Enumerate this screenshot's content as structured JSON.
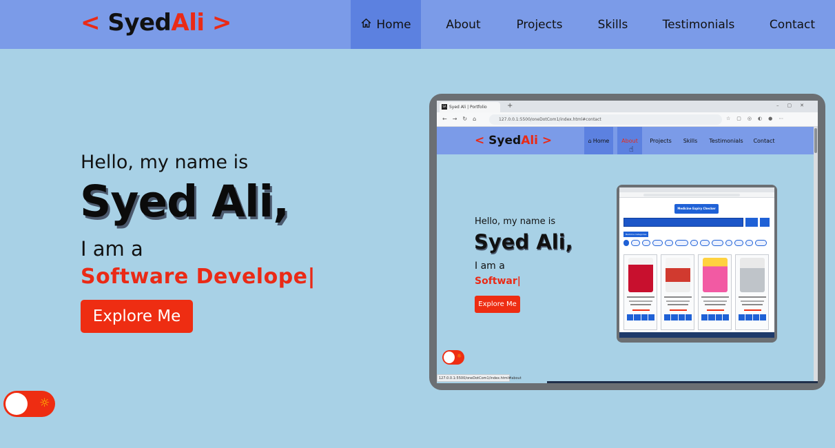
{
  "nav": {
    "logo": {
      "open": "< ",
      "first": "Syed",
      "last": "Ali",
      "close": " >"
    },
    "items": [
      {
        "label": "Home",
        "active": true,
        "icon": "home-icon"
      },
      {
        "label": "About"
      },
      {
        "label": "Projects"
      },
      {
        "label": "Skills"
      },
      {
        "label": "Testimonials"
      },
      {
        "label": "Contact"
      }
    ]
  },
  "hero": {
    "greeting": "Hello, my name is",
    "name": "Syed Ali,",
    "intro": "I am a",
    "role_typed": "Software Develope|",
    "cta": "Explore Me"
  },
  "theme_toggle": {
    "icon": "sun-icon",
    "symbol": "☼",
    "state": "light"
  },
  "preview": {
    "tab_title": "Syed Ali | Portfolio",
    "favicon": "SA",
    "url": "127.0.0.1:5500/oneDotCom1/index.html#contact",
    "status_url": "127.0.0.1:5500/oneDotCom1/index.html#about",
    "nav_items": [
      "Home",
      "About",
      "Projects",
      "Skills",
      "Testimonials",
      "Contact"
    ],
    "greeting": "Hello, my name is",
    "name": "Syed Ali,",
    "intro": "I am a",
    "role_typed": "Softwar|",
    "cta": "Explore Me",
    "inner_app_title": "Medicine Expiry Checker",
    "inner_app_category": "Medicine Categories"
  },
  "colors": {
    "background": "#a8d1e6",
    "nav": "#7b9be8",
    "nav_active": "#5c81e0",
    "accent": "#ea2a16",
    "button": "#ee2d12"
  }
}
